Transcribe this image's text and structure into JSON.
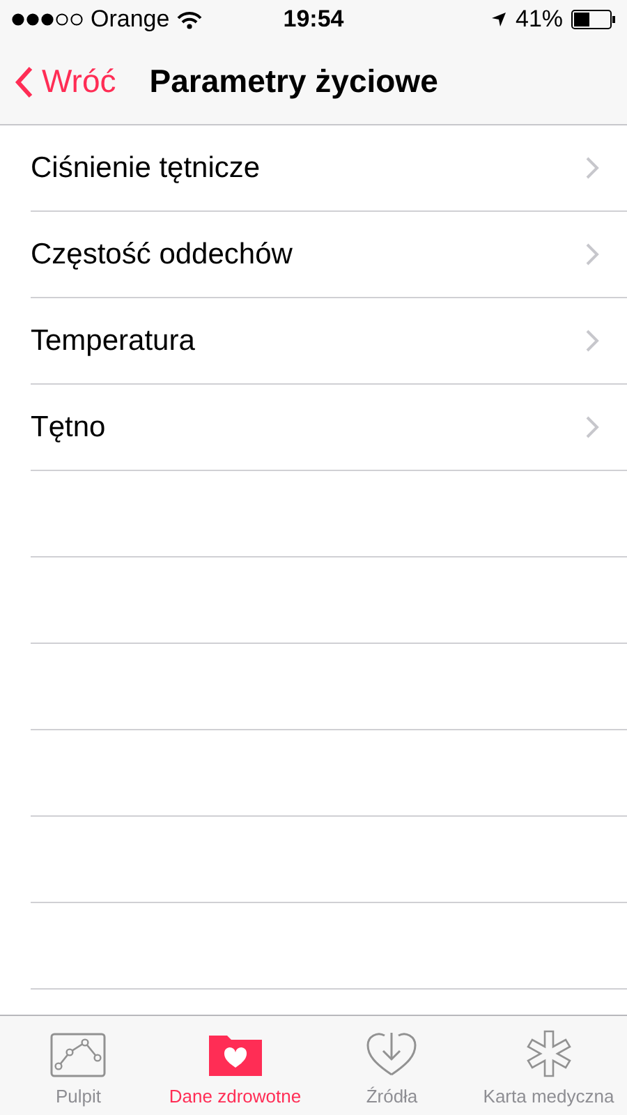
{
  "status_bar": {
    "carrier": "Orange",
    "time": "19:54",
    "battery": "41%"
  },
  "nav": {
    "back": "Wróć",
    "title": "Parametry życiowe"
  },
  "items": [
    {
      "label": "Ciśnienie tętnicze"
    },
    {
      "label": "Częstość oddechów"
    },
    {
      "label": "Temperatura"
    },
    {
      "label": "Tętno"
    }
  ],
  "tabs": [
    {
      "kind": "dashboard",
      "label": "Pulpit",
      "selected": false
    },
    {
      "kind": "health-data",
      "label": "Dane zdrowotne",
      "selected": true
    },
    {
      "kind": "sources",
      "label": "Źródła",
      "selected": false
    },
    {
      "kind": "medical-id",
      "label": "Karta medyczna",
      "selected": false
    }
  ]
}
